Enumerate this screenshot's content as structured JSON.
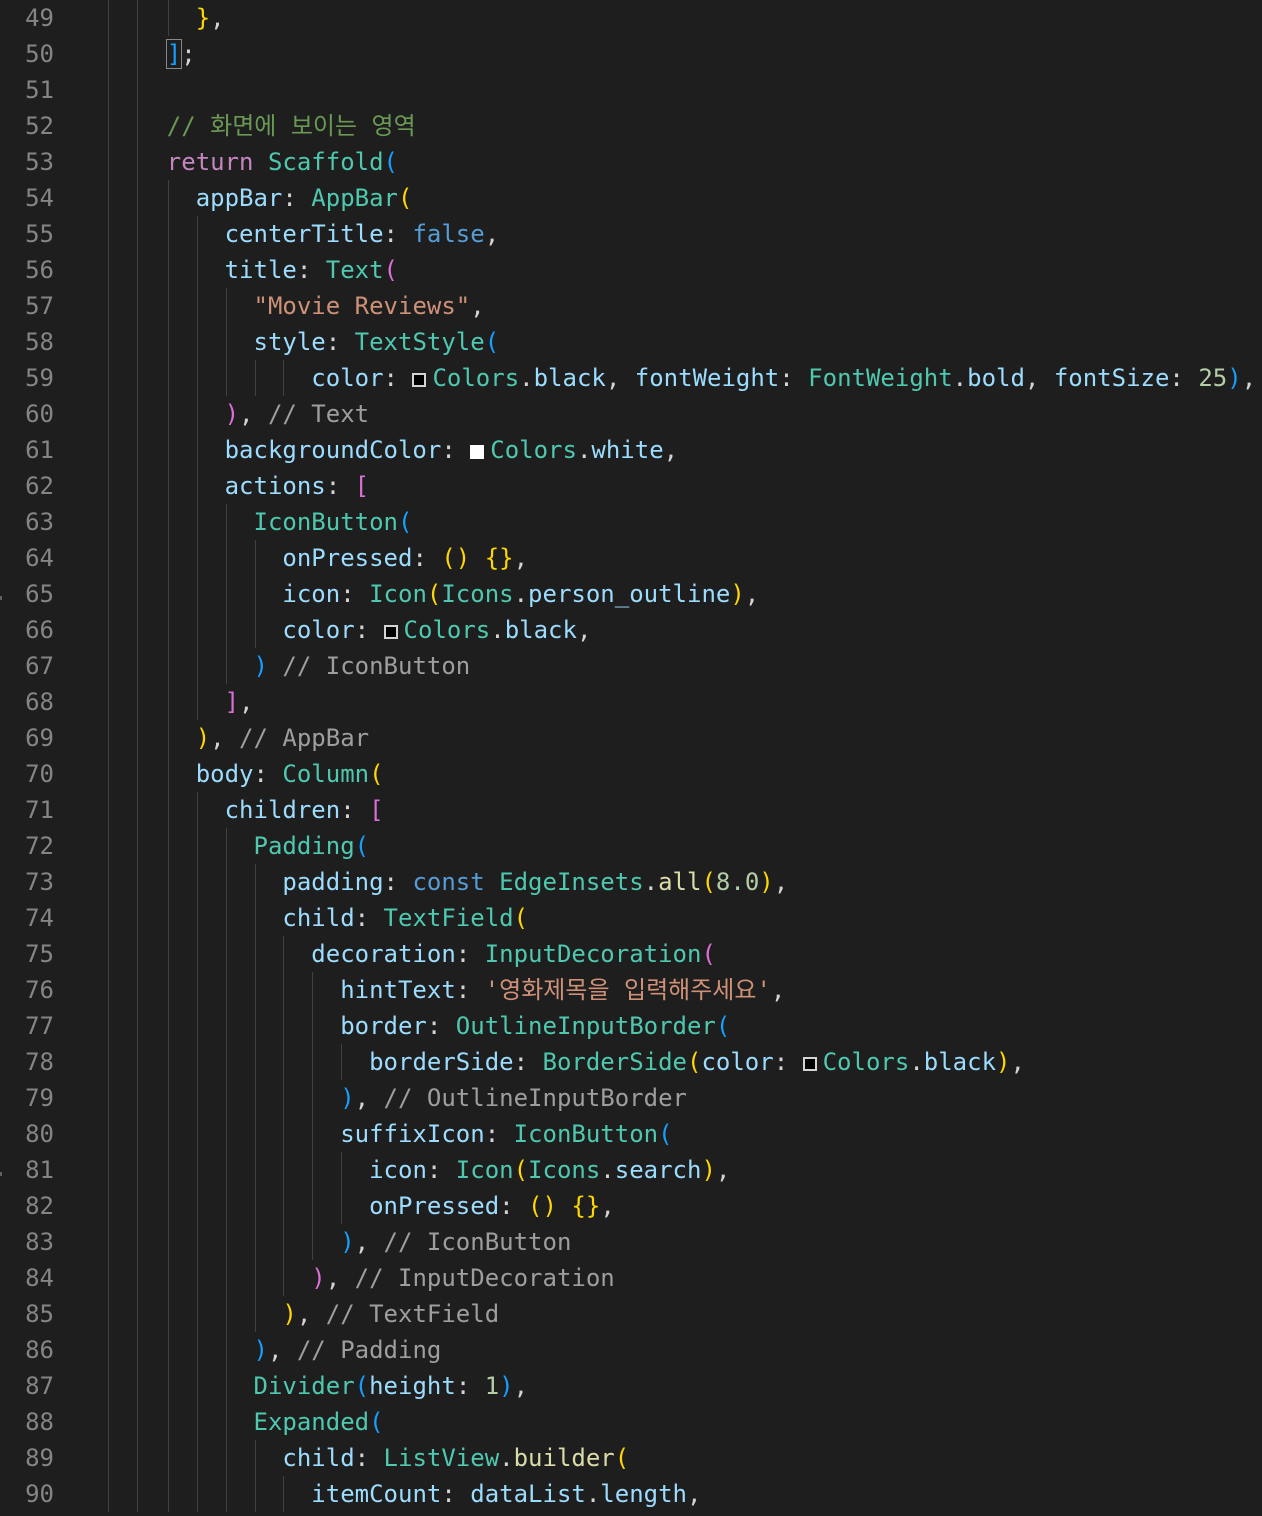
{
  "editor": {
    "colors": {
      "background": "#1e1e1e",
      "line_number": "#858585",
      "default": "#d4d4d4",
      "comment": "#9e9e9e",
      "keyword": "#c586c0",
      "class": "#4ec9b0",
      "property": "#9cdcfe",
      "string": "#ce9178",
      "number": "#b5cea8",
      "boolean": "#569cd6",
      "function": "#dcdcaa"
    },
    "lines": [
      {
        "n": "49",
        "indent": 6,
        "tokens": [
          {
            "t": "}",
            "c": "bracket-yellow"
          },
          {
            "t": ",",
            "c": "text"
          }
        ]
      },
      {
        "n": "50",
        "indent": 4,
        "tokens": [
          {
            "t": "]",
            "c": "bracket-blue",
            "cursor": true
          },
          {
            "t": ";",
            "c": "text"
          }
        ]
      },
      {
        "n": "51",
        "indent": 0,
        "tokens": []
      },
      {
        "n": "52",
        "indent": 4,
        "tokens": [
          {
            "t": "// 화면에 보이는 영역",
            "c": "comment-kr"
          }
        ]
      },
      {
        "n": "53",
        "indent": 4,
        "tokens": [
          {
            "t": "return",
            "c": "keyword"
          },
          {
            "t": " ",
            "c": "text"
          },
          {
            "t": "Scaffold",
            "c": "class"
          },
          {
            "t": "(",
            "c": "bracket-blue"
          }
        ]
      },
      {
        "n": "54",
        "indent": 6,
        "tokens": [
          {
            "t": "appBar",
            "c": "prop"
          },
          {
            "t": ": ",
            "c": "text"
          },
          {
            "t": "AppBar",
            "c": "class"
          },
          {
            "t": "(",
            "c": "bracket-yellow"
          }
        ]
      },
      {
        "n": "55",
        "indent": 8,
        "tokens": [
          {
            "t": "centerTitle",
            "c": "prop"
          },
          {
            "t": ": ",
            "c": "text"
          },
          {
            "t": "false",
            "c": "bool"
          },
          {
            "t": ",",
            "c": "text"
          }
        ]
      },
      {
        "n": "56",
        "indent": 8,
        "tokens": [
          {
            "t": "title",
            "c": "prop"
          },
          {
            "t": ": ",
            "c": "text"
          },
          {
            "t": "Text",
            "c": "class"
          },
          {
            "t": "(",
            "c": "bracket-pink"
          }
        ]
      },
      {
        "n": "57",
        "indent": 10,
        "tokens": [
          {
            "t": "\"Movie Reviews\"",
            "c": "string"
          },
          {
            "t": ",",
            "c": "text"
          }
        ]
      },
      {
        "n": "58",
        "indent": 10,
        "tokens": [
          {
            "t": "style",
            "c": "prop"
          },
          {
            "t": ": ",
            "c": "text"
          },
          {
            "t": "TextStyle",
            "c": "class"
          },
          {
            "t": "(",
            "c": "bracket-blue"
          }
        ]
      },
      {
        "n": "59",
        "indent": 14,
        "tokens": [
          {
            "t": "color",
            "c": "prop"
          },
          {
            "t": ": ",
            "c": "text"
          },
          {
            "swatch": "black"
          },
          {
            "t": "Colors",
            "c": "class"
          },
          {
            "t": ".",
            "c": "text"
          },
          {
            "t": "black",
            "c": "prop"
          },
          {
            "t": ", ",
            "c": "text"
          },
          {
            "t": "fontWeight",
            "c": "prop"
          },
          {
            "t": ": ",
            "c": "text"
          },
          {
            "t": "FontWeight",
            "c": "class"
          },
          {
            "t": ".",
            "c": "text"
          },
          {
            "t": "bold",
            "c": "prop"
          },
          {
            "t": ", ",
            "c": "text"
          },
          {
            "t": "fontSize",
            "c": "prop"
          },
          {
            "t": ": ",
            "c": "text"
          },
          {
            "t": "25",
            "c": "number"
          },
          {
            "t": ")",
            "c": "bracket-blue"
          },
          {
            "t": ",",
            "c": "text"
          }
        ]
      },
      {
        "n": "60",
        "indent": 8,
        "tokens": [
          {
            "t": ")",
            "c": "bracket-pink"
          },
          {
            "t": ", ",
            "c": "text"
          },
          {
            "t": "// Text",
            "c": "comment"
          }
        ]
      },
      {
        "n": "61",
        "indent": 8,
        "tokens": [
          {
            "t": "backgroundColor",
            "c": "prop"
          },
          {
            "t": ": ",
            "c": "text"
          },
          {
            "swatch": "white"
          },
          {
            "t": "Colors",
            "c": "class"
          },
          {
            "t": ".",
            "c": "text"
          },
          {
            "t": "white",
            "c": "prop"
          },
          {
            "t": ",",
            "c": "text"
          }
        ]
      },
      {
        "n": "62",
        "indent": 8,
        "tokens": [
          {
            "t": "actions",
            "c": "prop"
          },
          {
            "t": ": ",
            "c": "text"
          },
          {
            "t": "[",
            "c": "bracket-pink"
          }
        ]
      },
      {
        "n": "63",
        "indent": 10,
        "tokens": [
          {
            "t": "IconButton",
            "c": "class"
          },
          {
            "t": "(",
            "c": "bracket-blue"
          }
        ]
      },
      {
        "n": "64",
        "indent": 12,
        "tokens": [
          {
            "t": "onPressed",
            "c": "prop"
          },
          {
            "t": ": ",
            "c": "text"
          },
          {
            "t": "()",
            "c": "bracket-yellow"
          },
          {
            "t": " ",
            "c": "text"
          },
          {
            "t": "{}",
            "c": "bracket-yellow"
          },
          {
            "t": ",",
            "c": "text"
          }
        ]
      },
      {
        "n": "65",
        "indent": 12,
        "tokens": [
          {
            "t": "icon",
            "c": "prop"
          },
          {
            "t": ": ",
            "c": "text"
          },
          {
            "t": "Icon",
            "c": "class"
          },
          {
            "t": "(",
            "c": "bracket-yellow"
          },
          {
            "t": "Icons",
            "c": "class"
          },
          {
            "t": ".",
            "c": "text"
          },
          {
            "t": "person_outline",
            "c": "prop"
          },
          {
            "t": ")",
            "c": "bracket-yellow"
          },
          {
            "t": ",",
            "c": "text"
          }
        ],
        "tick": true
      },
      {
        "n": "66",
        "indent": 12,
        "tokens": [
          {
            "t": "color",
            "c": "prop"
          },
          {
            "t": ": ",
            "c": "text"
          },
          {
            "swatch": "black"
          },
          {
            "t": "Colors",
            "c": "class"
          },
          {
            "t": ".",
            "c": "text"
          },
          {
            "t": "black",
            "c": "prop"
          },
          {
            "t": ",",
            "c": "text"
          }
        ]
      },
      {
        "n": "67",
        "indent": 10,
        "tokens": [
          {
            "t": ")",
            "c": "bracket-blue"
          },
          {
            "t": " ",
            "c": "text"
          },
          {
            "t": "// IconButton",
            "c": "comment"
          }
        ]
      },
      {
        "n": "68",
        "indent": 8,
        "tokens": [
          {
            "t": "]",
            "c": "bracket-pink"
          },
          {
            "t": ",",
            "c": "text"
          }
        ]
      },
      {
        "n": "69",
        "indent": 6,
        "tokens": [
          {
            "t": ")",
            "c": "bracket-yellow"
          },
          {
            "t": ", ",
            "c": "text"
          },
          {
            "t": "// AppBar",
            "c": "comment"
          }
        ]
      },
      {
        "n": "70",
        "indent": 6,
        "tokens": [
          {
            "t": "body",
            "c": "prop"
          },
          {
            "t": ": ",
            "c": "text"
          },
          {
            "t": "Column",
            "c": "class"
          },
          {
            "t": "(",
            "c": "bracket-yellow"
          }
        ]
      },
      {
        "n": "71",
        "indent": 8,
        "tokens": [
          {
            "t": "children",
            "c": "prop"
          },
          {
            "t": ": ",
            "c": "text"
          },
          {
            "t": "[",
            "c": "bracket-pink"
          }
        ]
      },
      {
        "n": "72",
        "indent": 10,
        "tokens": [
          {
            "t": "Padding",
            "c": "class"
          },
          {
            "t": "(",
            "c": "bracket-blue"
          }
        ]
      },
      {
        "n": "73",
        "indent": 12,
        "tokens": [
          {
            "t": "padding",
            "c": "prop"
          },
          {
            "t": ": ",
            "c": "text"
          },
          {
            "t": "const",
            "c": "bool"
          },
          {
            "t": " ",
            "c": "text"
          },
          {
            "t": "EdgeInsets",
            "c": "class"
          },
          {
            "t": ".",
            "c": "text"
          },
          {
            "t": "all",
            "c": "fn"
          },
          {
            "t": "(",
            "c": "bracket-yellow"
          },
          {
            "t": "8.0",
            "c": "number"
          },
          {
            "t": ")",
            "c": "bracket-yellow"
          },
          {
            "t": ",",
            "c": "text"
          }
        ]
      },
      {
        "n": "74",
        "indent": 12,
        "tokens": [
          {
            "t": "child",
            "c": "prop"
          },
          {
            "t": ": ",
            "c": "text"
          },
          {
            "t": "TextField",
            "c": "class"
          },
          {
            "t": "(",
            "c": "bracket-yellow"
          }
        ]
      },
      {
        "n": "75",
        "indent": 14,
        "tokens": [
          {
            "t": "decoration",
            "c": "prop"
          },
          {
            "t": ": ",
            "c": "text"
          },
          {
            "t": "InputDecoration",
            "c": "class"
          },
          {
            "t": "(",
            "c": "bracket-pink"
          }
        ]
      },
      {
        "n": "76",
        "indent": 16,
        "tokens": [
          {
            "t": "hintText",
            "c": "prop"
          },
          {
            "t": ": ",
            "c": "text"
          },
          {
            "t": "'영화제목을 입력해주세요'",
            "c": "string"
          },
          {
            "t": ",",
            "c": "text"
          }
        ]
      },
      {
        "n": "77",
        "indent": 16,
        "tokens": [
          {
            "t": "border",
            "c": "prop"
          },
          {
            "t": ": ",
            "c": "text"
          },
          {
            "t": "OutlineInputBorder",
            "c": "class"
          },
          {
            "t": "(",
            "c": "bracket-blue"
          }
        ]
      },
      {
        "n": "78",
        "indent": 18,
        "tokens": [
          {
            "t": "borderSide",
            "c": "prop"
          },
          {
            "t": ": ",
            "c": "text"
          },
          {
            "t": "BorderSide",
            "c": "class"
          },
          {
            "t": "(",
            "c": "bracket-yellow"
          },
          {
            "t": "color",
            "c": "prop"
          },
          {
            "t": ": ",
            "c": "text"
          },
          {
            "swatch": "black"
          },
          {
            "t": "Colors",
            "c": "class"
          },
          {
            "t": ".",
            "c": "text"
          },
          {
            "t": "black",
            "c": "prop"
          },
          {
            "t": ")",
            "c": "bracket-yellow"
          },
          {
            "t": ",",
            "c": "text"
          }
        ]
      },
      {
        "n": "79",
        "indent": 16,
        "tokens": [
          {
            "t": ")",
            "c": "bracket-blue"
          },
          {
            "t": ", ",
            "c": "text"
          },
          {
            "t": "// OutlineInputBorder",
            "c": "comment"
          }
        ]
      },
      {
        "n": "80",
        "indent": 16,
        "tokens": [
          {
            "t": "suffixIcon",
            "c": "prop"
          },
          {
            "t": ": ",
            "c": "text"
          },
          {
            "t": "IconButton",
            "c": "class"
          },
          {
            "t": "(",
            "c": "bracket-blue"
          }
        ]
      },
      {
        "n": "81",
        "indent": 18,
        "tokens": [
          {
            "t": "icon",
            "c": "prop"
          },
          {
            "t": ": ",
            "c": "text"
          },
          {
            "t": "Icon",
            "c": "class"
          },
          {
            "t": "(",
            "c": "bracket-yellow"
          },
          {
            "t": "Icons",
            "c": "class"
          },
          {
            "t": ".",
            "c": "text"
          },
          {
            "t": "search",
            "c": "prop"
          },
          {
            "t": ")",
            "c": "bracket-yellow"
          },
          {
            "t": ",",
            "c": "text"
          }
        ],
        "tick": true
      },
      {
        "n": "82",
        "indent": 18,
        "tokens": [
          {
            "t": "onPressed",
            "c": "prop"
          },
          {
            "t": ": ",
            "c": "text"
          },
          {
            "t": "()",
            "c": "bracket-yellow"
          },
          {
            "t": " ",
            "c": "text"
          },
          {
            "t": "{}",
            "c": "bracket-yellow"
          },
          {
            "t": ",",
            "c": "text"
          }
        ]
      },
      {
        "n": "83",
        "indent": 16,
        "tokens": [
          {
            "t": ")",
            "c": "bracket-blue"
          },
          {
            "t": ", ",
            "c": "text"
          },
          {
            "t": "// IconButton",
            "c": "comment"
          }
        ]
      },
      {
        "n": "84",
        "indent": 14,
        "tokens": [
          {
            "t": ")",
            "c": "bracket-pink"
          },
          {
            "t": ", ",
            "c": "text"
          },
          {
            "t": "// InputDecoration",
            "c": "comment"
          }
        ]
      },
      {
        "n": "85",
        "indent": 12,
        "tokens": [
          {
            "t": ")",
            "c": "bracket-yellow"
          },
          {
            "t": ", ",
            "c": "text"
          },
          {
            "t": "// TextField",
            "c": "comment"
          }
        ]
      },
      {
        "n": "86",
        "indent": 10,
        "tokens": [
          {
            "t": ")",
            "c": "bracket-blue"
          },
          {
            "t": ", ",
            "c": "text"
          },
          {
            "t": "// Padding",
            "c": "comment"
          }
        ]
      },
      {
        "n": "87",
        "indent": 10,
        "tokens": [
          {
            "t": "Divider",
            "c": "class"
          },
          {
            "t": "(",
            "c": "bracket-blue"
          },
          {
            "t": "height",
            "c": "prop"
          },
          {
            "t": ": ",
            "c": "text"
          },
          {
            "t": "1",
            "c": "number"
          },
          {
            "t": ")",
            "c": "bracket-blue"
          },
          {
            "t": ",",
            "c": "text"
          }
        ]
      },
      {
        "n": "88",
        "indent": 10,
        "tokens": [
          {
            "t": "Expanded",
            "c": "class"
          },
          {
            "t": "(",
            "c": "bracket-blue"
          }
        ]
      },
      {
        "n": "89",
        "indent": 12,
        "tokens": [
          {
            "t": "child",
            "c": "prop"
          },
          {
            "t": ": ",
            "c": "text"
          },
          {
            "t": "ListView",
            "c": "class"
          },
          {
            "t": ".",
            "c": "text"
          },
          {
            "t": "builder",
            "c": "fn"
          },
          {
            "t": "(",
            "c": "bracket-yellow"
          }
        ]
      },
      {
        "n": "90",
        "indent": 14,
        "tokens": [
          {
            "t": "itemCount",
            "c": "prop"
          },
          {
            "t": ": ",
            "c": "text"
          },
          {
            "t": "dataList",
            "c": "prop"
          },
          {
            "t": ".",
            "c": "text"
          },
          {
            "t": "length",
            "c": "prop"
          },
          {
            "t": ",",
            "c": "text"
          }
        ]
      }
    ]
  }
}
